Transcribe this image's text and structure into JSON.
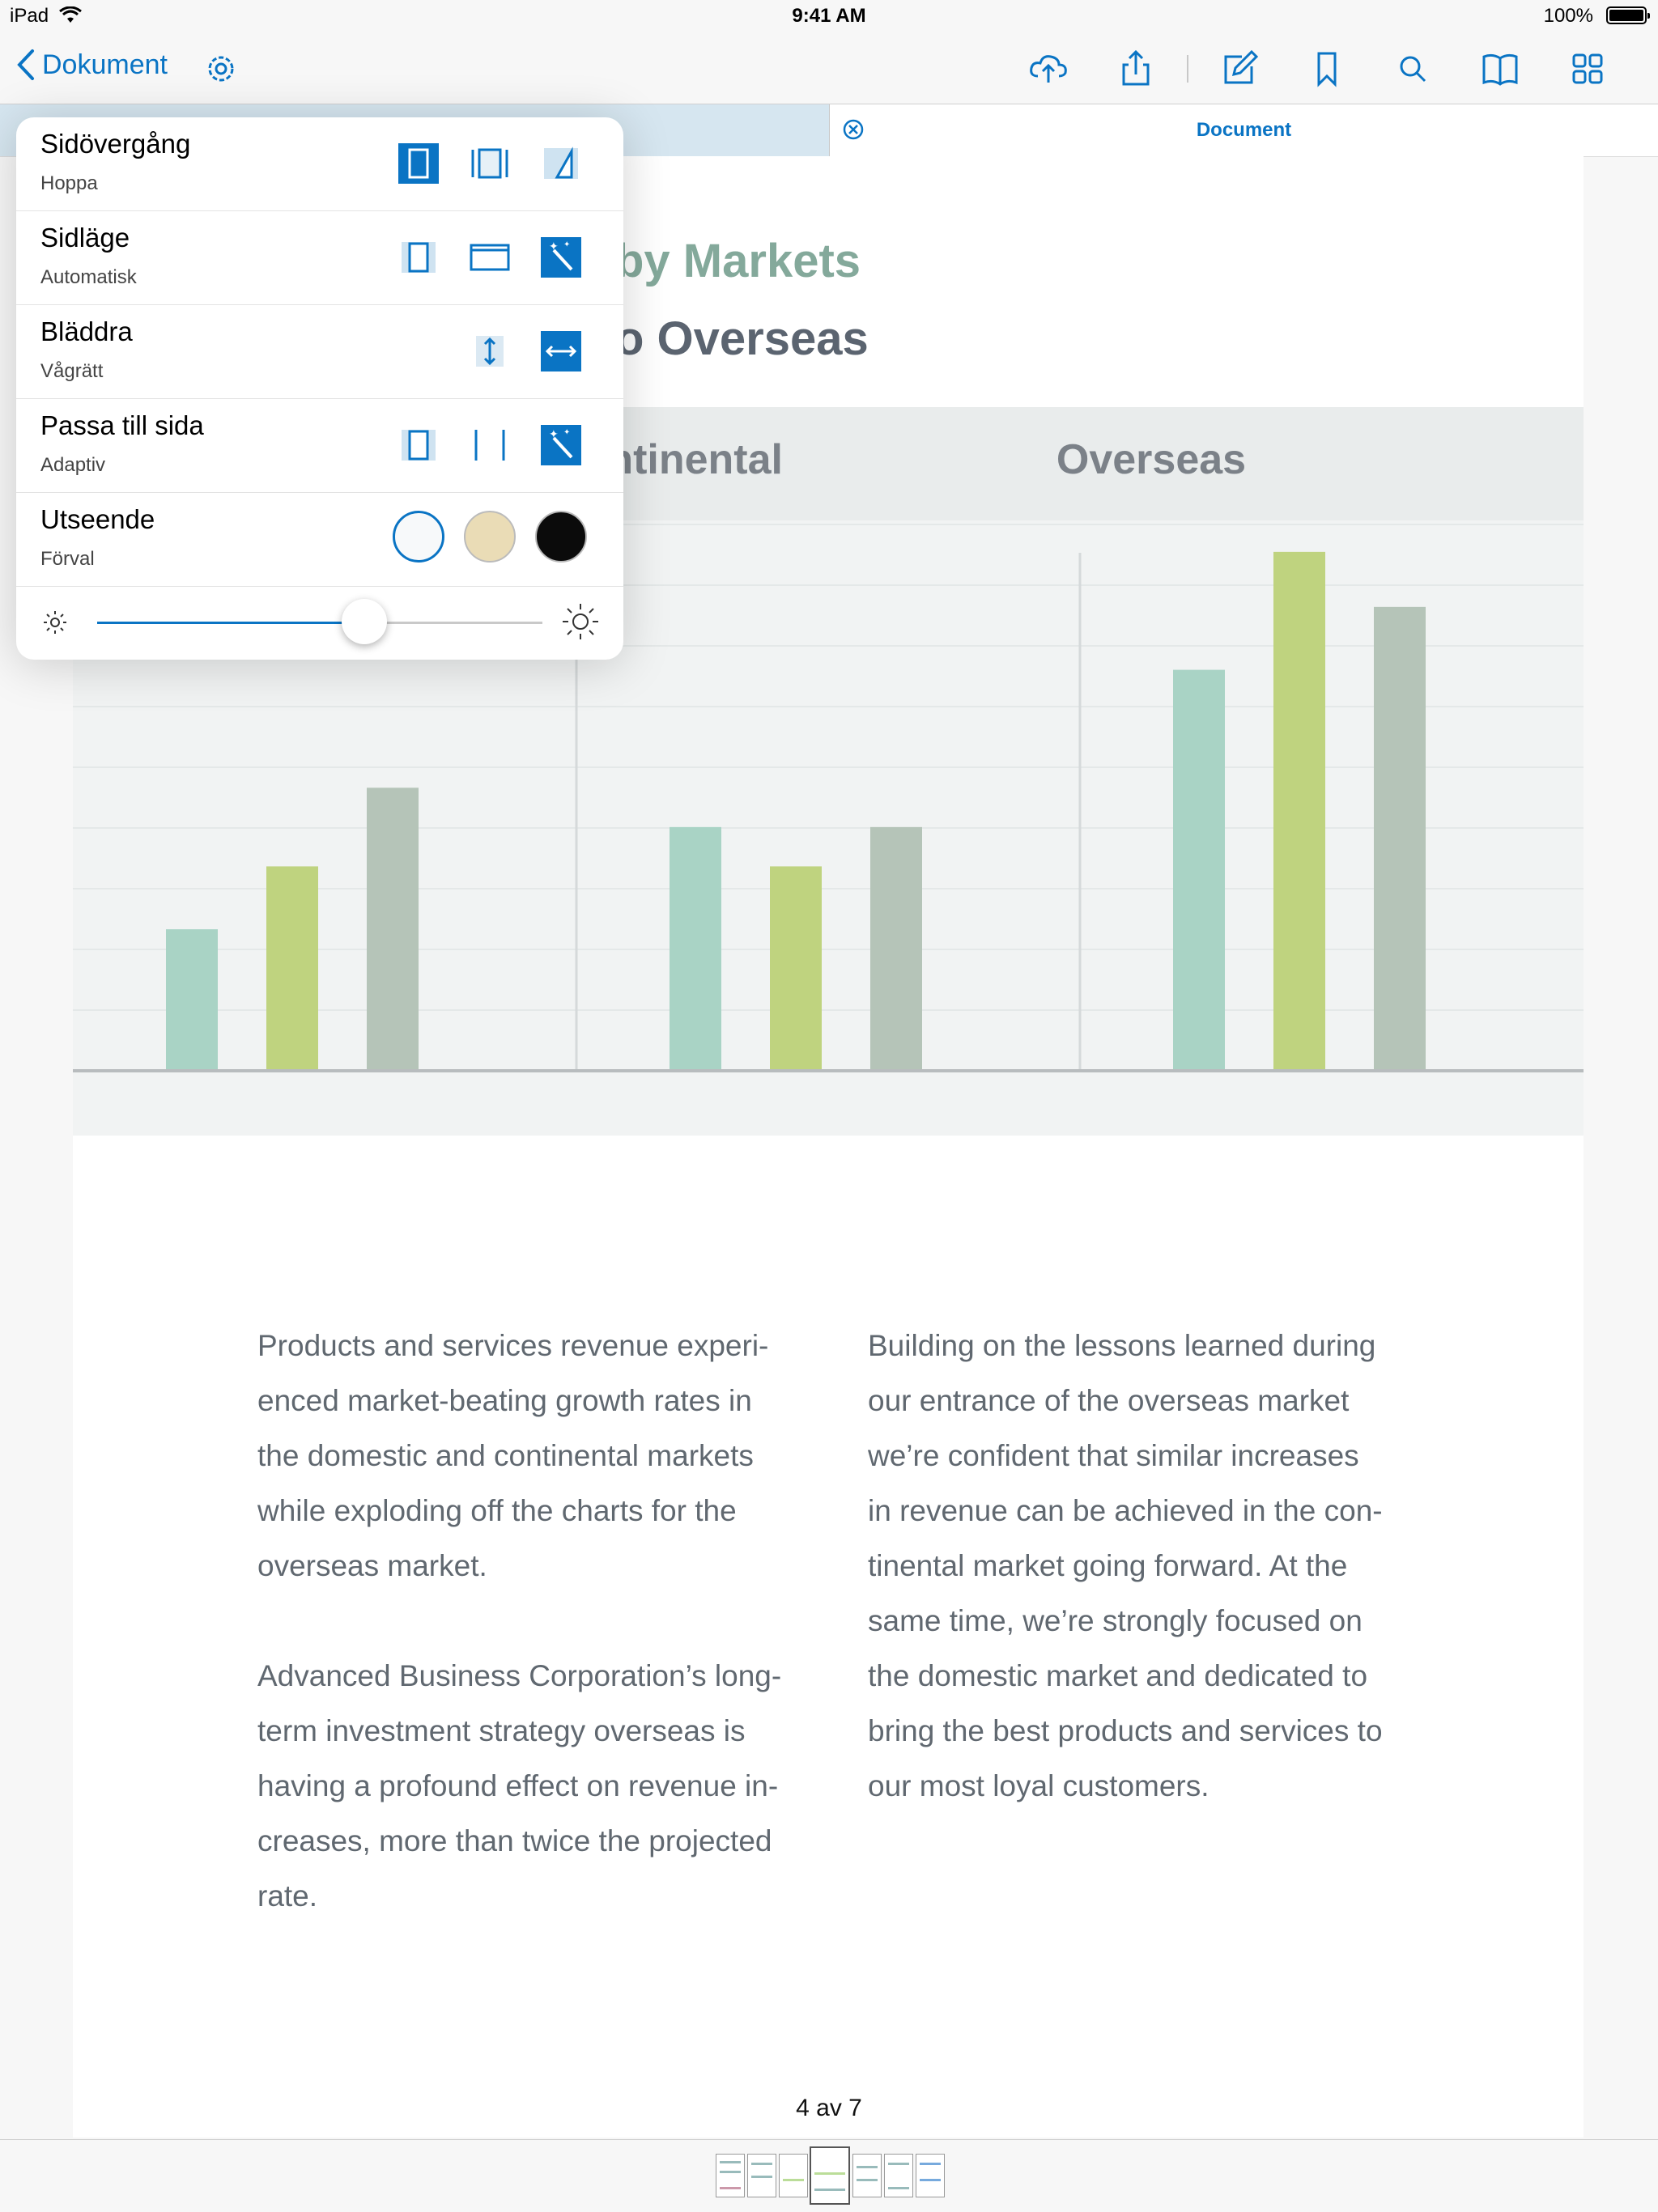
{
  "status_bar": {
    "device": "iPad",
    "time": "9:41 AM",
    "battery": "100%"
  },
  "nav": {
    "back_label": "Dokument"
  },
  "tab": {
    "title": "Document"
  },
  "document": {
    "title_line1": "by Markets",
    "title_line2": "o Overseas",
    "columns": [
      "Continental",
      "Overseas"
    ],
    "paragraph1": "Products and services revenue experi-\nenced market-beating growth rates in\nthe domestic and continental markets\nwhile exploding off the charts for the\noverseas market.",
    "paragraph2": "Advanced Business Corporation’s long-\nterm investment strategy overseas is\nhaving a profound effect on revenue in-\ncreases, more than twice the projected\nrate.",
    "paragraph3": "Building on the lessons learned during\nour entrance of the overseas market\nwe’re confident that similar increases\nin revenue can be achieved in the con-\ntinental market going forward. At the\nsame time, we’re strongly focused on\nthe domestic market and dedicated to\nbring the best products and services to\nour most loyal customers."
  },
  "page_indicator": "4 av 7",
  "popover": {
    "rows": [
      {
        "label": "Sidövergång",
        "value": "Hoppa"
      },
      {
        "label": "Sidläge",
        "value": "Automatisk"
      },
      {
        "label": "Bläddra",
        "value": "Vågrätt"
      },
      {
        "label": "Passa till sida",
        "value": "Adaptiv"
      },
      {
        "label": "Utseende",
        "value": "Förval"
      }
    ],
    "brightness": 0.6
  },
  "colors": {
    "accent": "#0a74c4",
    "bar_teal": "#a9d3c5",
    "bar_green": "#bfd37f",
    "bar_gray": "#b5c4b8"
  },
  "chart_data": {
    "type": "bar",
    "categories": [
      "",
      "Continental",
      "Overseas"
    ],
    "series": [
      {
        "values": [
          90,
          155,
          255
        ]
      },
      {
        "values": [
          130,
          130,
          330
        ]
      },
      {
        "values": [
          180,
          155,
          295
        ]
      }
    ],
    "ylim": [
      0,
      350
    ]
  }
}
